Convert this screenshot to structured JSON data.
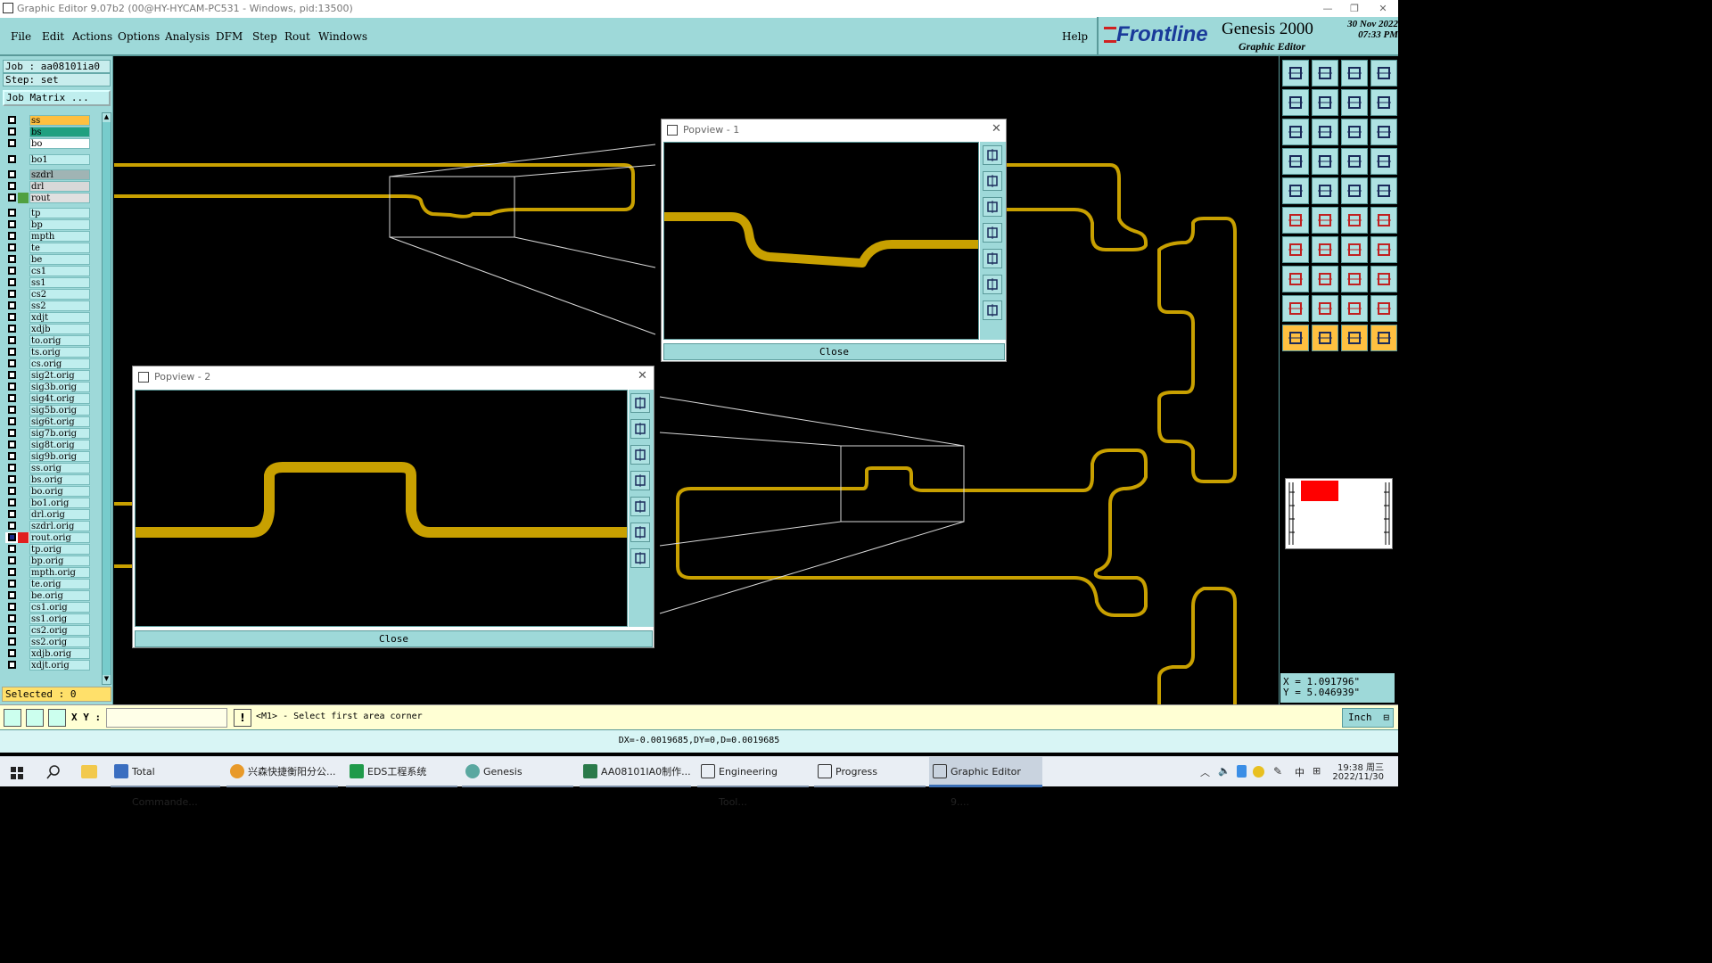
{
  "window": {
    "title": "Graphic Editor 9.07b2 (00@HY-HYCAM-PC531 - Windows, pid:13500)"
  },
  "menu": [
    "File",
    "Edit",
    "Actions",
    "Options",
    "Analysis",
    "DFM",
    "Step",
    "Rout",
    "Windows"
  ],
  "help_label": "Help",
  "brand": {
    "logo": "Frontline",
    "product": "Genesis 2000",
    "subtitle": "Graphic Editor",
    "date": "30 Nov 2022",
    "time": "07:33 PM"
  },
  "job": {
    "job_line": "Job : aa08101ia0",
    "step_line": "Step: set",
    "matrix_button": "Job Matrix ..."
  },
  "layers": [
    {
      "name": "ss",
      "color": "#ffc040"
    },
    {
      "name": "bs",
      "color": "#20a080"
    },
    {
      "name": "bo",
      "color": "#ffffff"
    },
    {
      "name": "bo1",
      "color": ""
    },
    {
      "name": "szdrl",
      "color": "#a0b4b4"
    },
    {
      "name": "drl",
      "color": "#d8d8d8"
    },
    {
      "name": "rout",
      "color": "#e0e0e0",
      "swatch": "#50a040"
    },
    {
      "name": "tp",
      "color": ""
    },
    {
      "name": "bp",
      "color": ""
    },
    {
      "name": "mpth",
      "color": ""
    },
    {
      "name": "te",
      "color": ""
    },
    {
      "name": "be",
      "color": ""
    },
    {
      "name": "cs1",
      "color": ""
    },
    {
      "name": "ss1",
      "color": ""
    },
    {
      "name": "cs2",
      "color": ""
    },
    {
      "name": "ss2",
      "color": ""
    },
    {
      "name": "xdjt",
      "color": ""
    },
    {
      "name": "xdjb",
      "color": ""
    },
    {
      "name": "to.orig",
      "color": ""
    },
    {
      "name": "ts.orig",
      "color": ""
    },
    {
      "name": "cs.orig",
      "color": ""
    },
    {
      "name": "sig2t.orig",
      "color": ""
    },
    {
      "name": "sig3b.orig",
      "color": ""
    },
    {
      "name": "sig4t.orig",
      "color": ""
    },
    {
      "name": "sig5b.orig",
      "color": ""
    },
    {
      "name": "sig6t.orig",
      "color": ""
    },
    {
      "name": "sig7b.orig",
      "color": ""
    },
    {
      "name": "sig8t.orig",
      "color": ""
    },
    {
      "name": "sig9b.orig",
      "color": ""
    },
    {
      "name": "ss.orig",
      "color": ""
    },
    {
      "name": "bs.orig",
      "color": ""
    },
    {
      "name": "bo.orig",
      "color": ""
    },
    {
      "name": "bo1.orig",
      "color": ""
    },
    {
      "name": "drl.orig",
      "color": ""
    },
    {
      "name": "szdrl.orig",
      "color": ""
    },
    {
      "name": "rout.orig",
      "color": "",
      "swatch": "#e02020",
      "work": true
    },
    {
      "name": "tp.orig",
      "color": ""
    },
    {
      "name": "bp.orig",
      "color": ""
    },
    {
      "name": "mpth.orig",
      "color": ""
    },
    {
      "name": "te.orig",
      "color": ""
    },
    {
      "name": "be.orig",
      "color": ""
    },
    {
      "name": "cs1.orig",
      "color": ""
    },
    {
      "name": "ss1.orig",
      "color": ""
    },
    {
      "name": "cs2.orig",
      "color": ""
    },
    {
      "name": "ss2.orig",
      "color": ""
    },
    {
      "name": "xdjb.orig",
      "color": ""
    },
    {
      "name": "xdjt.orig",
      "color": ""
    }
  ],
  "selected": "Selected : 0",
  "popview1": {
    "title": "Popview - 1",
    "close": "Close"
  },
  "popview2": {
    "title": "Popview - 2",
    "close": "Close"
  },
  "coords": {
    "x": "X = 1.091796\"",
    "y": "Y = 5.046939\""
  },
  "bottom": {
    "xy_label": "X Y :",
    "xy_value": "",
    "prompt": "<M1> - Select first area corner",
    "units": "Inch"
  },
  "status": "DX=-0.0019685,DY=0,D=0.0019685",
  "taskbar": {
    "items": [
      "Total Commande...",
      "兴森快捷衡阳分公...",
      "EDS工程系统",
      "Genesis",
      "AA08101IA0制作...",
      "Engineering Tool...",
      "Progress",
      "Graphic Editor 9...."
    ],
    "clock_time": "19:38 周三",
    "clock_date": "2022/11/30",
    "ime": "中"
  },
  "colors": {
    "trace": "#c8a000",
    "panel": "#9ed9d9",
    "canvas": "#000000"
  }
}
